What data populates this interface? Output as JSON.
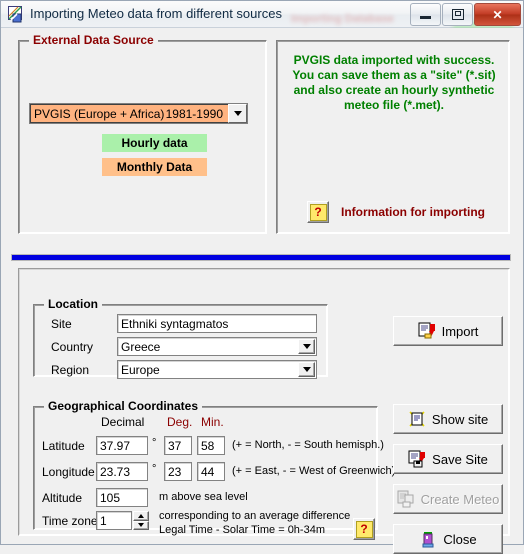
{
  "window": {
    "title": "Importing Meteo data from different sources",
    "app_icon": "meteo-chart-icon",
    "watermark_text": "Importing Database",
    "controls": {
      "minimize": "minimize-icon",
      "maximize": "maximize-icon",
      "close": "✕"
    }
  },
  "external_data_source": {
    "legend": "External Data Source",
    "source_combo": {
      "name": "PVGIS  (Europe + Africa)",
      "years": "1981-1990"
    },
    "hourly_button": "Hourly data",
    "monthly_button": "Monthly Data"
  },
  "message_panel": {
    "line1": "PVGIS data imported with success.",
    "line2": "You can save them as a \"site\" (*.sit)",
    "line3": "and also create an hourly synthetic",
    "line4": "meteo file  (*.met).",
    "info_button_icon": "question-mark-icon",
    "info_label": "Information for importing",
    "text_color": "#008000",
    "info_label_color": "#8b0000"
  },
  "location": {
    "legend": "Location",
    "site_label": "Site",
    "site_value": "Ethniki syntagmatos",
    "country_label": "Country",
    "country_value": "Greece",
    "region_label": "Region",
    "region_value": "Europe"
  },
  "coordinates": {
    "legend": "Geographical Coordinates",
    "header_decimal": "Decimal",
    "header_deg": "Deg.",
    "header_min": "Min.",
    "degree_symbol": "°",
    "latitude_label": "Latitude",
    "latitude_decimal": "37.97",
    "latitude_deg": "37",
    "latitude_min": "58",
    "latitude_hint": "(+ = North,  - = South hemisph.)",
    "longitude_label": "Longitude",
    "longitude_decimal": "23.73",
    "longitude_deg": "23",
    "longitude_min": "44",
    "longitude_hint": "(+ = East, - = West of Greenwich)",
    "altitude_label": "Altitude",
    "altitude_value": "105",
    "altitude_hint": "m above sea level",
    "timezone_label": "Time zone",
    "timezone_value": "1",
    "timezone_hint_line1": "corresponding to an average difference",
    "timezone_hint_line2": "Legal Time - Solar Time =   0h-34m",
    "help_icon": "question-mark-icon"
  },
  "actions": {
    "import": "Import",
    "show_site": "Show site",
    "save_site": "Save Site",
    "create_meteo": "Create Meteo",
    "close": "Close"
  },
  "colors": {
    "face": "#f0f0f0",
    "orange": "#ffb380",
    "green_tag": "#aaf0aa",
    "orange_tag": "#ffc08a",
    "blue_rule": "#0000e0",
    "dark_red": "#8b0000",
    "success_green": "#008000"
  }
}
